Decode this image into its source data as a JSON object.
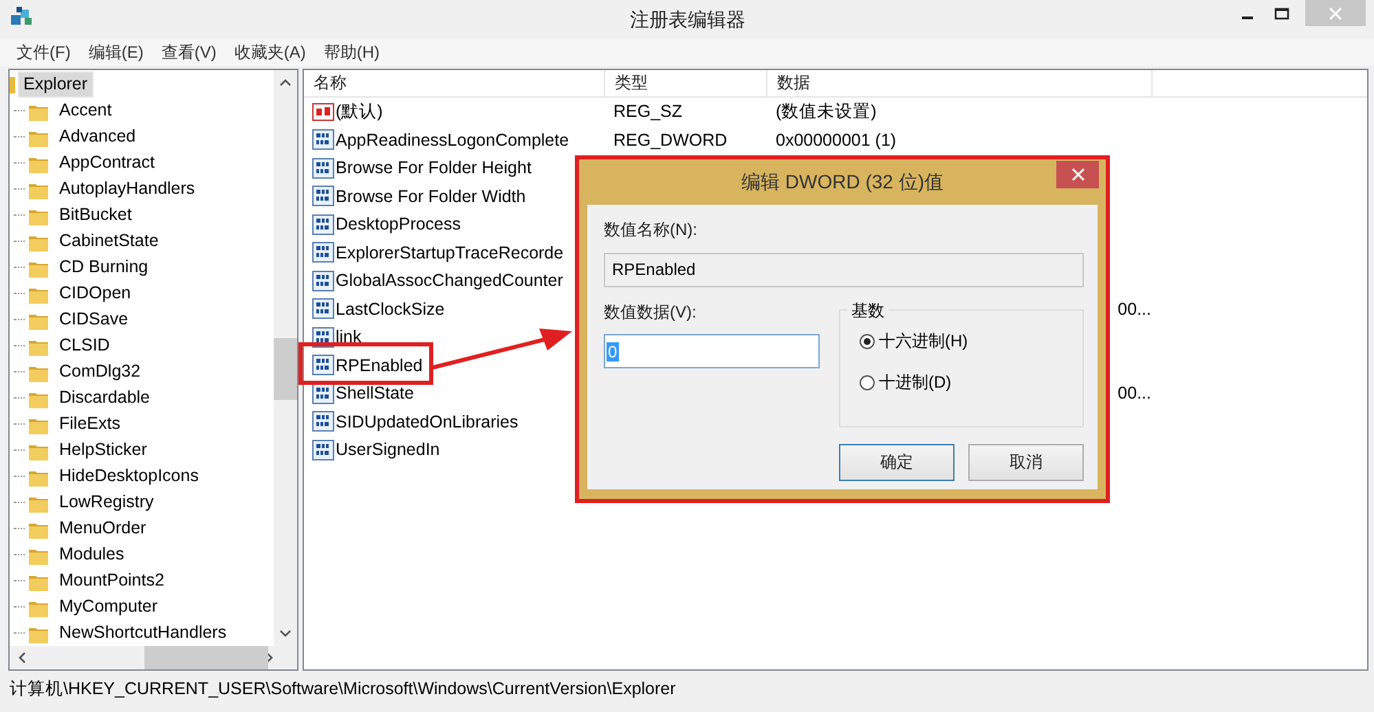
{
  "window": {
    "title": "注册表编辑器"
  },
  "menu": [
    {
      "label": "文件(F)"
    },
    {
      "label": "编辑(E)"
    },
    {
      "label": "查看(V)"
    },
    {
      "label": "收藏夹(A)"
    },
    {
      "label": "帮助(H)"
    }
  ],
  "tree": {
    "items": [
      {
        "label": "Explorer",
        "selected": true,
        "children": [
          {
            "label": "Accent",
            "selected": false
          },
          {
            "label": "Advanced",
            "selected": false
          },
          {
            "label": "AppContract",
            "selected": false
          },
          {
            "label": "AutoplayHandlers",
            "selected": false
          },
          {
            "label": "BitBucket",
            "selected": false
          },
          {
            "label": "CabinetState",
            "selected": false
          },
          {
            "label": "CD Burning",
            "selected": false
          },
          {
            "label": "CIDOpen",
            "selected": false
          },
          {
            "label": "CIDSave",
            "selected": false
          },
          {
            "label": "CLSID",
            "selected": false
          },
          {
            "label": "ComDlg32",
            "selected": false
          },
          {
            "label": "Discardable",
            "selected": false
          },
          {
            "label": "FileExts",
            "selected": false
          },
          {
            "label": "HelpSticker",
            "selected": false
          },
          {
            "label": "HideDesktopIcons",
            "selected": false
          },
          {
            "label": "LowRegistry",
            "selected": false
          },
          {
            "label": "MenuOrder",
            "selected": false
          },
          {
            "label": "Modules",
            "selected": false
          },
          {
            "label": "MountPoints2",
            "selected": false
          },
          {
            "label": "MyComputer",
            "selected": false
          },
          {
            "label": "NewShortcutHandlers",
            "selected": false
          }
        ]
      }
    ]
  },
  "table": {
    "columns": [
      "名称",
      "类型",
      "数据"
    ],
    "rows": [
      {
        "kind": "string",
        "name": "(默认)",
        "type": "REG_SZ",
        "data": "(数值未设置)"
      },
      {
        "kind": "binary",
        "name": "AppReadinessLogonComplete",
        "type": "REG_DWORD",
        "data": "0x00000001 (1)"
      },
      {
        "kind": "binary",
        "name": "Browse For Folder Height"
      },
      {
        "kind": "binary",
        "name": "Browse For Folder Width"
      },
      {
        "kind": "binary",
        "name": "DesktopProcess"
      },
      {
        "kind": "binary",
        "name": "ExplorerStartupTraceRecorde"
      },
      {
        "kind": "binary",
        "name": "GlobalAssocChangedCounter"
      },
      {
        "kind": "binary",
        "name": "LastClockSize",
        "data": "00...",
        "partial": true
      },
      {
        "kind": "binary",
        "name": "link"
      },
      {
        "kind": "binary",
        "name": "RPEnabled"
      },
      {
        "kind": "binary",
        "name": "ShellState",
        "data": "00...",
        "partial": true
      },
      {
        "kind": "binary",
        "name": "SIDUpdatedOnLibraries"
      },
      {
        "kind": "binary",
        "name": "UserSignedIn"
      }
    ]
  },
  "dialog": {
    "title": "编辑 DWORD (32 位)值",
    "name_label": "数值名称(N):",
    "name_value": "RPEnabled",
    "data_label": "数值数据(V):",
    "data_value": "0",
    "base_label": "基数",
    "radios": [
      {
        "label": "十六进制(H)",
        "selected": true
      },
      {
        "label": "十进制(D)",
        "selected": false
      }
    ],
    "buttons": [
      {
        "label": "确定",
        "default": true
      },
      {
        "label": "取消",
        "default": false
      }
    ]
  },
  "status_bar": "计算机\\HKEY_CURRENT_USER\\Software\\Microsoft\\Windows\\CurrentVersion\\Explorer"
}
